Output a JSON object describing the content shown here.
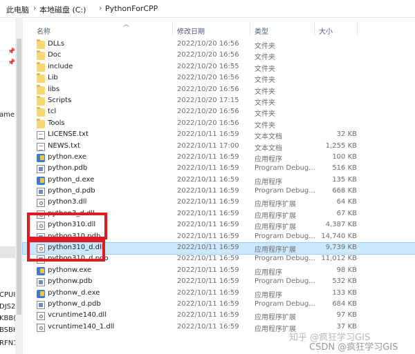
{
  "breadcrumb": {
    "items": [
      "此电脑",
      "本地磁盘 (C:)",
      "PythonForCPP"
    ],
    "separator": "›"
  },
  "columns": {
    "name": "名称",
    "modified": "修改日期",
    "type": "类型",
    "size": "大小"
  },
  "nav": {
    "items": [
      "ame",
      "CPUI",
      "DJS2",
      "KBB(",
      "BSBH",
      "RFN1"
    ]
  },
  "files": [
    {
      "name": "DLLs",
      "modified": "2022/10/20 16:56",
      "type": "文件夹",
      "size": "",
      "icon": "folder-icon"
    },
    {
      "name": "Doc",
      "modified": "2022/10/20 16:56",
      "type": "文件夹",
      "size": "",
      "icon": "folder-icon"
    },
    {
      "name": "include",
      "modified": "2022/10/20 16:55",
      "type": "文件夹",
      "size": "",
      "icon": "folder-icon"
    },
    {
      "name": "Lib",
      "modified": "2022/10/20 16:56",
      "type": "文件夹",
      "size": "",
      "icon": "folder-icon"
    },
    {
      "name": "libs",
      "modified": "2022/10/20 16:56",
      "type": "文件夹",
      "size": "",
      "icon": "folder-icon"
    },
    {
      "name": "Scripts",
      "modified": "2022/10/20 17:15",
      "type": "文件夹",
      "size": "",
      "icon": "folder-icon"
    },
    {
      "name": "tcl",
      "modified": "2022/10/20 16:56",
      "type": "文件夹",
      "size": "",
      "icon": "folder-icon"
    },
    {
      "name": "Tools",
      "modified": "2022/10/20 16:56",
      "type": "文件夹",
      "size": "",
      "icon": "folder-icon"
    },
    {
      "name": "LICENSE.txt",
      "modified": "2022/10/11 16:59",
      "type": "文本文档",
      "size": "32 KB",
      "icon": "text-file-icon"
    },
    {
      "name": "NEWS.txt",
      "modified": "2022/10/11 17:00",
      "type": "文本文档",
      "size": "1,255 KB",
      "icon": "text-file-icon"
    },
    {
      "name": "python.exe",
      "modified": "2022/10/11 16:59",
      "type": "应用程序",
      "size": "100 KB",
      "icon": "python-exe-icon"
    },
    {
      "name": "python.pdb",
      "modified": "2022/10/11 16:59",
      "type": "Program Debug...",
      "size": "516 KB",
      "icon": "pdb-file-icon"
    },
    {
      "name": "python_d.exe",
      "modified": "2022/10/11 16:59",
      "type": "应用程序",
      "size": "135 KB",
      "icon": "python-exe-icon"
    },
    {
      "name": "python_d.pdb",
      "modified": "2022/10/11 16:59",
      "type": "Program Debug...",
      "size": "668 KB",
      "icon": "pdb-file-icon"
    },
    {
      "name": "python3.dll",
      "modified": "2022/10/11 16:59",
      "type": "应用程序扩展",
      "size": "64 KB",
      "icon": "dll-file-icon"
    },
    {
      "name": "python3_d.dll",
      "modified": "2022/10/11 16:59",
      "type": "应用程序扩展",
      "size": "67 KB",
      "icon": "dll-file-icon"
    },
    {
      "name": "python310.dll",
      "modified": "2022/10/11 16:59",
      "type": "应用程序扩展",
      "size": "4,387 KB",
      "icon": "dll-file-icon"
    },
    {
      "name": "python310.pdb",
      "modified": "2022/10/11 16:59",
      "type": "Program Debug...",
      "size": "14,740 KB",
      "icon": "pdb-file-icon"
    },
    {
      "name": "python310_d.dll",
      "modified": "2022/10/11 16:59",
      "type": "应用程序扩展",
      "size": "9,739 KB",
      "icon": "dll-file-icon"
    },
    {
      "name": "python310_d.pdb",
      "modified": "2022/10/11 16:59",
      "type": "Program Debug...",
      "size": "11,012 KB",
      "icon": "pdb-file-icon"
    },
    {
      "name": "pythonw.exe",
      "modified": "2022/10/11 16:59",
      "type": "应用程序",
      "size": "98 KB",
      "icon": "python-exe-icon"
    },
    {
      "name": "pythonw.pdb",
      "modified": "2022/10/11 16:59",
      "type": "Program Debug...",
      "size": "532 KB",
      "icon": "pdb-file-icon"
    },
    {
      "name": "pythonw_d.exe",
      "modified": "2022/10/11 16:59",
      "type": "应用程序",
      "size": "133 KB",
      "icon": "python-exe-icon"
    },
    {
      "name": "pythonw_d.pdb",
      "modified": "2022/10/11 16:59",
      "type": "Program Debug...",
      "size": "684 KB",
      "icon": "pdb-file-icon"
    },
    {
      "name": "vcruntime140.dll",
      "modified": "2022/10/11 16:59",
      "type": "应用程序扩展",
      "size": "97 KB",
      "icon": "dll-file-icon"
    },
    {
      "name": "vcruntime140_1.dll",
      "modified": "2022/10/11 16:59",
      "type": "应用程序扩展",
      "size": "37 KB",
      "icon": "dll-file-icon"
    }
  ],
  "selected_file": "python310_d.dll",
  "watermark": {
    "line1": "知乎 @疯狂学习GIS",
    "line2": "CSDN @疯狂学习GIS"
  },
  "colors": {
    "selection": "#cce8ff",
    "annotation": "#e0191f",
    "folder": "#f8d775"
  }
}
